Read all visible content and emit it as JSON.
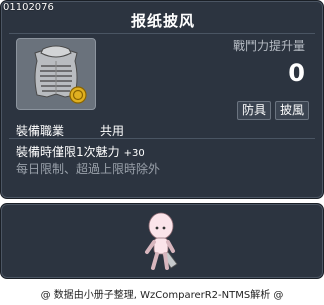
{
  "item": {
    "id": "01102076",
    "title": "报纸披风",
    "stat_label": "戰鬥力提升量",
    "stat_value": "0",
    "tags": [
      "防具",
      "披風"
    ],
    "job_label": "裝備職業",
    "job_value": "共用",
    "equip_text": "裝備時僅限1次魅力",
    "equip_bonus": "+30",
    "limit_text": "每日限制、超過上限時除外",
    "icon": "newspaper-cape-icon"
  },
  "footer": {
    "text": "@ 数据由小册子整理, WzComparerR2-NTMS解析 @"
  },
  "colors": {
    "panel_bg": "#2c3440",
    "panel_border": "#4b5563",
    "muted_text": "#9aa1aa",
    "coin": "#e0b020"
  }
}
